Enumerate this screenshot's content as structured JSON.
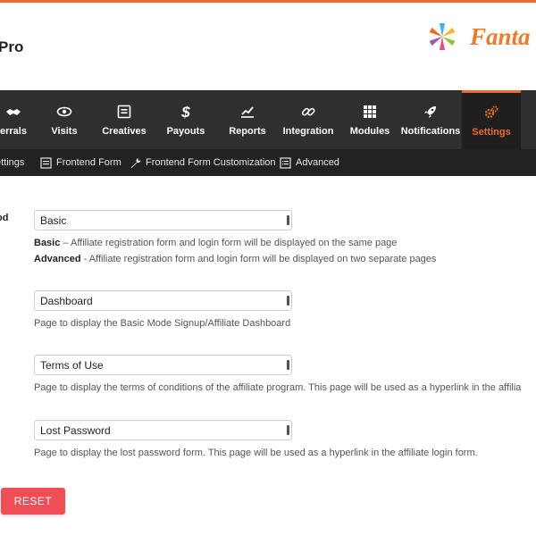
{
  "header": {
    "app_title": "Pro",
    "brand_text": "Fanta"
  },
  "nav": {
    "items": [
      {
        "label": "errals",
        "icon": "handshake-icon"
      },
      {
        "label": "Visits",
        "icon": "eye-icon"
      },
      {
        "label": "Creatives",
        "icon": "image-frame-icon"
      },
      {
        "label": "Payouts",
        "icon": "dollar-icon"
      },
      {
        "label": "Reports",
        "icon": "line-chart-icon"
      },
      {
        "label": "Integration",
        "icon": "link-icon"
      },
      {
        "label": "Modules",
        "icon": "grid-icon"
      },
      {
        "label": "Notifications",
        "icon": "rocket-icon"
      },
      {
        "label": "Settings",
        "icon": "cogs-icon"
      }
    ],
    "active": "Settings"
  },
  "subnav": {
    "items": [
      {
        "label": "ettings"
      },
      {
        "label": "Frontend Form",
        "icon": "form-icon"
      },
      {
        "label": "Frontend Form Customization",
        "icon": "wrench-icon"
      },
      {
        "label": "Advanced",
        "icon": "list-icon"
      }
    ]
  },
  "form": {
    "mode_label": "od",
    "mode_value": "Basic",
    "mode_help_basic_term": "Basic",
    "mode_help_basic_text": " – Affiliate registration form and login form will be displayed on the same page",
    "mode_help_advanced_term": "Advanced",
    "mode_help_advanced_text": " - Affiliate registration form and login form will be displayed on two separate pages",
    "dashboard_value": "Dashboard",
    "dashboard_help": "Page to display the Basic Mode Signup/Affiliate Dashboard",
    "terms_value": "Terms of Use",
    "terms_help": "Page to display the terms of conditions of the affiliate program. This page will be used as a hyperlink in the affilia",
    "lostpw_value": "Lost Password",
    "lostpw_help": "Page to display the lost password form. This page will be used as a hyperlink in the affiliate login form."
  },
  "actions": {
    "reset_label": "RESET"
  },
  "colors": {
    "accent": "#f26a2b",
    "nav_bg": "#2f2f2f",
    "subnav_bg": "#222222",
    "reset_bg": "#ef4e57"
  }
}
